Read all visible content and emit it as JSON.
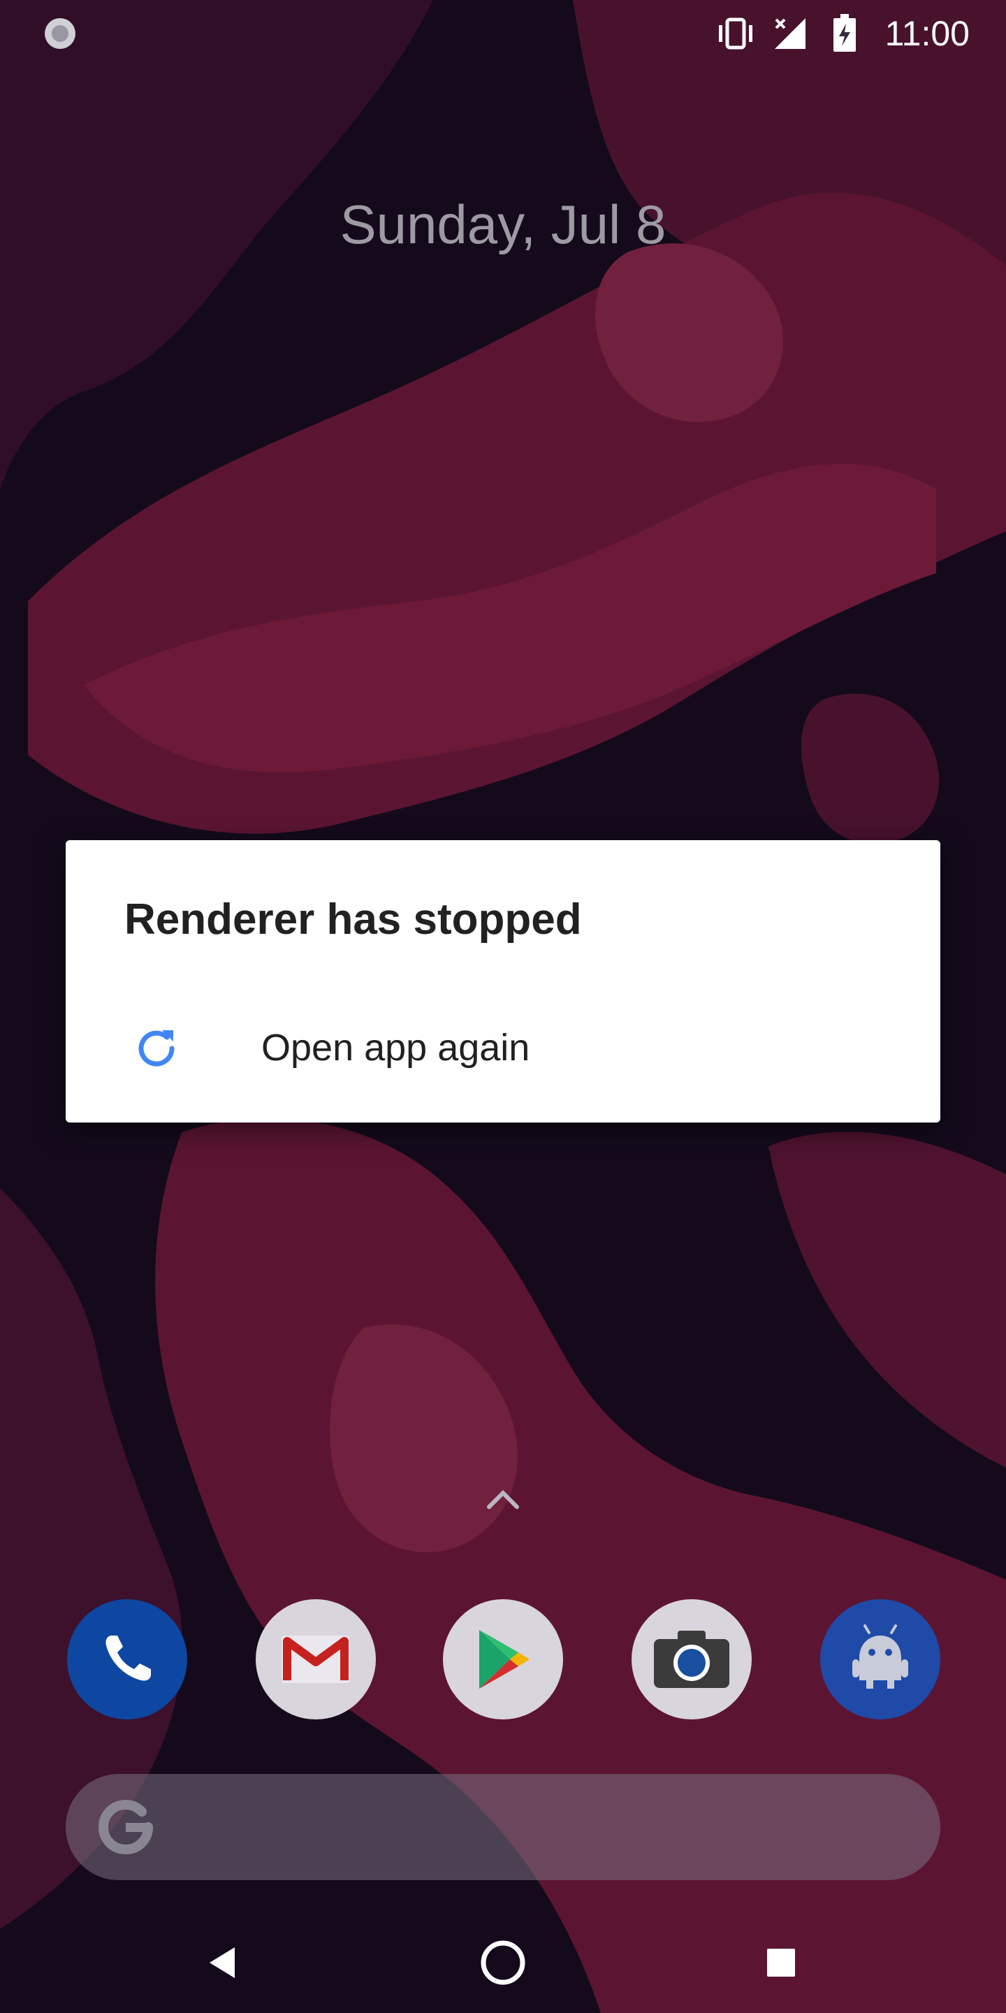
{
  "status_bar": {
    "time": "11:00",
    "icons": [
      "sync-icon",
      "vibrate-icon",
      "signal-icon",
      "battery-charging-icon"
    ]
  },
  "lockscreen": {
    "date": "Sunday, Jul 8"
  },
  "dialog": {
    "title": "Renderer has stopped",
    "actions": [
      {
        "label": "Open app again",
        "icon": "refresh-icon"
      }
    ]
  },
  "dock": {
    "apps": [
      "phone-icon",
      "gmail-icon",
      "play-store-icon",
      "camera-icon",
      "android-app-icon"
    ]
  },
  "search": {
    "icon": "google-g-icon"
  },
  "navigation": {
    "buttons": [
      "back-icon",
      "home-icon",
      "recents-icon"
    ]
  },
  "colors": {
    "dialog_bg": "#ffffff",
    "accent_blue": "#4285f4",
    "wallpaper_dark": "#1a0f22",
    "wallpaper_red": "#8c1f45"
  }
}
